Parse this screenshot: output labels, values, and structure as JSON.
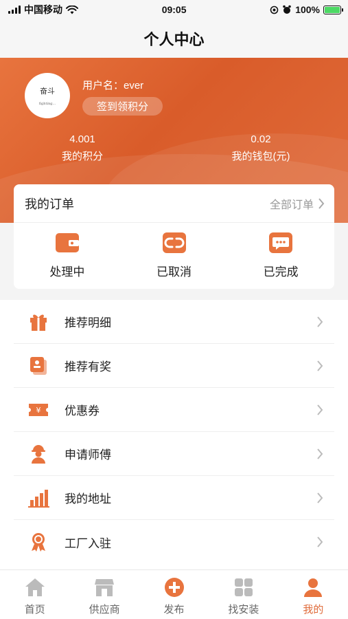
{
  "status_bar": {
    "carrier": "中国移动",
    "time": "09:05",
    "battery": "100%"
  },
  "nav": {
    "title": "个人中心"
  },
  "profile": {
    "avatar_text_1": "奋斗",
    "avatar_text_2": "fighting...",
    "username": "用户名：ever",
    "sign_button": "签到领积分",
    "points_value": "4.001",
    "points_label": "我的积分",
    "wallet_value": "0.02",
    "wallet_label": "我的钱包(元)"
  },
  "orders": {
    "title": "我的订单",
    "all_label": "全部订单",
    "items": [
      {
        "label": "处理中",
        "icon": "wallet-icon"
      },
      {
        "label": "已取消",
        "icon": "cancel-link-icon"
      },
      {
        "label": "已完成",
        "icon": "chat-bubble-icon"
      }
    ]
  },
  "menu": {
    "items": [
      {
        "label": "推荐明细",
        "icon": "gift-icon"
      },
      {
        "label": "推荐有奖",
        "icon": "reward-card-icon"
      },
      {
        "label": "优惠券",
        "icon": "coupon-icon"
      },
      {
        "label": "申请师傅",
        "icon": "worker-icon"
      },
      {
        "label": "我的地址",
        "icon": "bar-chart-icon"
      },
      {
        "label": "工厂入驻",
        "icon": "badge-icon"
      }
    ]
  },
  "tabbar": {
    "items": [
      {
        "label": "首页",
        "icon": "home-icon"
      },
      {
        "label": "供应商",
        "icon": "shop-icon"
      },
      {
        "label": "发布",
        "icon": "plus-circle-icon"
      },
      {
        "label": "找安装",
        "icon": "grid-icon"
      },
      {
        "label": "我的",
        "icon": "user-icon"
      }
    ],
    "active_index": 4
  },
  "colors": {
    "accent": "#e06b3a",
    "accent_dark": "#d95c2a",
    "inactive_icon": "#bbbbbb"
  }
}
